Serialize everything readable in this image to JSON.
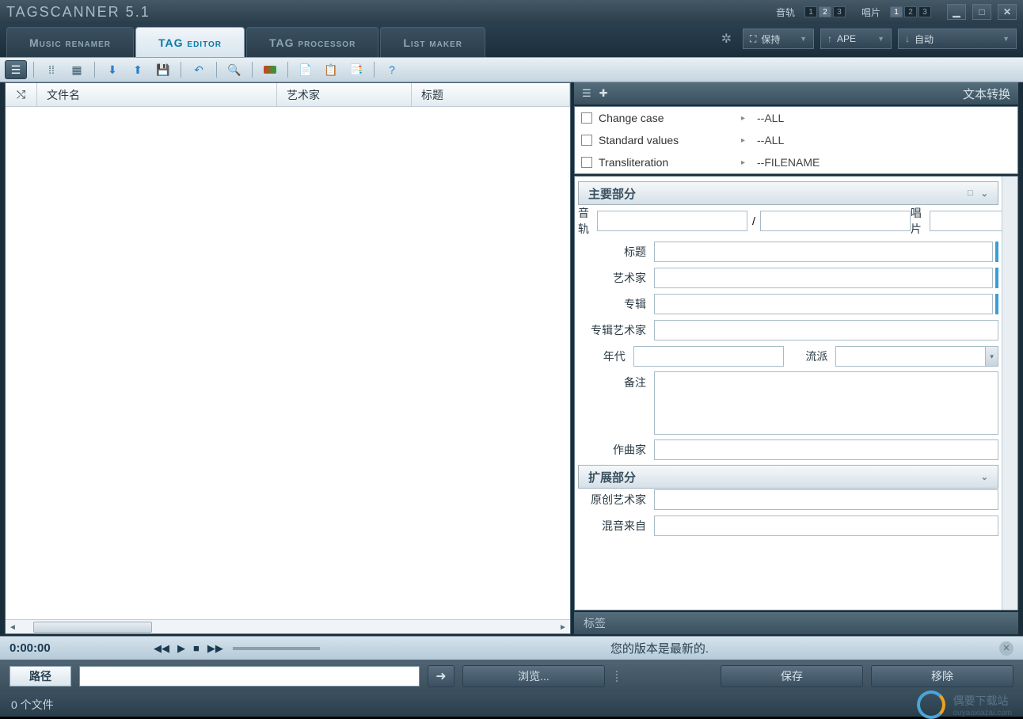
{
  "app": {
    "title": "TAGSCANNER 5.1"
  },
  "titlebar": {
    "track_label": "音轨",
    "disc_label": "唱片",
    "nums": [
      "1",
      "2",
      "3"
    ]
  },
  "tabs": {
    "music_renamer": "Music renamer",
    "tag_editor": "TAG editor",
    "tag_processor": "TAG processor",
    "list_maker": "List maker"
  },
  "tab_dropdowns": {
    "keep_prefix": "⛶",
    "keep": "保持",
    "ape_prefix": "↑",
    "ape": "APE",
    "auto_prefix": "↓",
    "auto": "自动"
  },
  "file_table": {
    "cols": {
      "shuffle": "⤭",
      "filename": "文件名",
      "artist": "艺术家",
      "title": "标题"
    }
  },
  "text_transform": {
    "title": "文本转换",
    "rows": [
      {
        "name": "Change case",
        "value": "--ALL"
      },
      {
        "name": "Standard values",
        "value": "--ALL"
      },
      {
        "name": "Transliteration",
        "value": "--FILENAME"
      }
    ]
  },
  "main_section": {
    "title": "主要部分"
  },
  "form": {
    "track": "音轨",
    "disc": "唱片",
    "title": "标题",
    "artist": "艺术家",
    "album": "专辑",
    "album_artist": "专辑艺术家",
    "year": "年代",
    "genre": "流派",
    "comment": "备注",
    "composer": "作曲家"
  },
  "ext_section": {
    "title": "扩展部分"
  },
  "ext_form": {
    "orig_artist": "原创艺术家",
    "remix": "混音来自"
  },
  "tags_bar": {
    "label": "标签"
  },
  "player": {
    "time": "0:00:00",
    "status": "您的版本是最新的."
  },
  "path_bar": {
    "label": "路径",
    "browse": "浏览...",
    "save": "保存",
    "remove": "移除"
  },
  "status": {
    "files": "0 个文件"
  },
  "watermark": {
    "text": "偶要下载站",
    "url": "ouyaoxiazai.com"
  }
}
